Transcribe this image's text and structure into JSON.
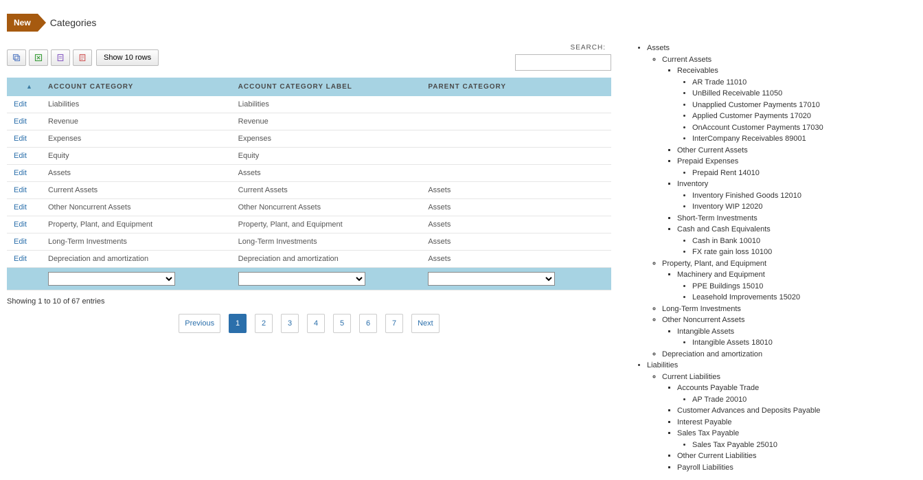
{
  "header": {
    "new_label": "New",
    "page_title": "Categories"
  },
  "toolbar": {
    "show_rows_label": "Show 10 rows",
    "search_label": "SEARCH:"
  },
  "table": {
    "columns": {
      "edit": "",
      "category": "ACCOUNT CATEGORY",
      "label": "ACCOUNT CATEGORY LABEL",
      "parent": "PARENT CATEGORY"
    },
    "edit_label": "Edit",
    "rows": [
      {
        "category": "Liabilities",
        "label": "Liabilities",
        "parent": ""
      },
      {
        "category": "Revenue",
        "label": "Revenue",
        "parent": ""
      },
      {
        "category": "Expenses",
        "label": "Expenses",
        "parent": ""
      },
      {
        "category": "Equity",
        "label": "Equity",
        "parent": ""
      },
      {
        "category": "Assets",
        "label": "Assets",
        "parent": ""
      },
      {
        "category": "Current Assets",
        "label": "Current Assets",
        "parent": "Assets"
      },
      {
        "category": "Other Noncurrent Assets",
        "label": "Other Noncurrent Assets",
        "parent": "Assets"
      },
      {
        "category": "Property, Plant, and Equipment",
        "label": "Property, Plant, and Equipment",
        "parent": "Assets"
      },
      {
        "category": "Long-Term Investments",
        "label": "Long-Term Investments",
        "parent": "Assets"
      },
      {
        "category": "Depreciation and amortization",
        "label": "Depreciation and amortization",
        "parent": "Assets"
      }
    ]
  },
  "info": "Showing 1 to 10 of 67 entries",
  "pagination": {
    "previous": "Previous",
    "pages": [
      "1",
      "2",
      "3",
      "4",
      "5",
      "6",
      "7"
    ],
    "active": "1",
    "next": "Next"
  },
  "tree": [
    {
      "label": "Assets",
      "children": [
        {
          "label": "Current Assets",
          "children": [
            {
              "label": "Receivables",
              "children": [
                {
                  "label": "AR Trade 11010"
                },
                {
                  "label": "UnBilled Receivable 11050"
                },
                {
                  "label": "Unapplied Customer Payments 17010"
                },
                {
                  "label": "Applied Customer Payments 17020"
                },
                {
                  "label": "OnAccount Customer Payments 17030"
                },
                {
                  "label": "InterCompany Receivables 89001"
                }
              ]
            },
            {
              "label": "Other Current Assets"
            },
            {
              "label": "Prepaid Expenses",
              "children": [
                {
                  "label": "Prepaid Rent 14010"
                }
              ]
            },
            {
              "label": "Inventory",
              "children": [
                {
                  "label": "Inventory Finished Goods 12010"
                },
                {
                  "label": "Inventory WIP 12020"
                }
              ]
            },
            {
              "label": "Short-Term Investments"
            },
            {
              "label": "Cash and Cash Equivalents",
              "children": [
                {
                  "label": "Cash in Bank 10010"
                },
                {
                  "label": "FX rate gain loss 10100"
                }
              ]
            }
          ]
        },
        {
          "label": "Property, Plant, and Equipment",
          "children": [
            {
              "label": "Machinery and Equipment",
              "children": [
                {
                  "label": "PPE Buildings 15010"
                },
                {
                  "label": "Leasehold Improvements 15020"
                }
              ]
            }
          ]
        },
        {
          "label": "Long-Term Investments"
        },
        {
          "label": "Other Noncurrent Assets",
          "children": [
            {
              "label": "Intangible Assets",
              "children": [
                {
                  "label": "Intangible Assets 18010"
                }
              ]
            }
          ]
        },
        {
          "label": "Depreciation and amortization"
        }
      ]
    },
    {
      "label": "Liabilities",
      "children": [
        {
          "label": "Current Liabilities",
          "children": [
            {
              "label": "Accounts Payable Trade",
              "children": [
                {
                  "label": "AP Trade 20010"
                }
              ]
            },
            {
              "label": "Customer Advances and Deposits Payable"
            },
            {
              "label": "Interest Payable"
            },
            {
              "label": "Sales Tax Payable",
              "children": [
                {
                  "label": "Sales Tax Payable 25010"
                }
              ]
            },
            {
              "label": "Other Current Liabilities"
            },
            {
              "label": "Payroll Liabilities"
            }
          ]
        }
      ]
    }
  ]
}
